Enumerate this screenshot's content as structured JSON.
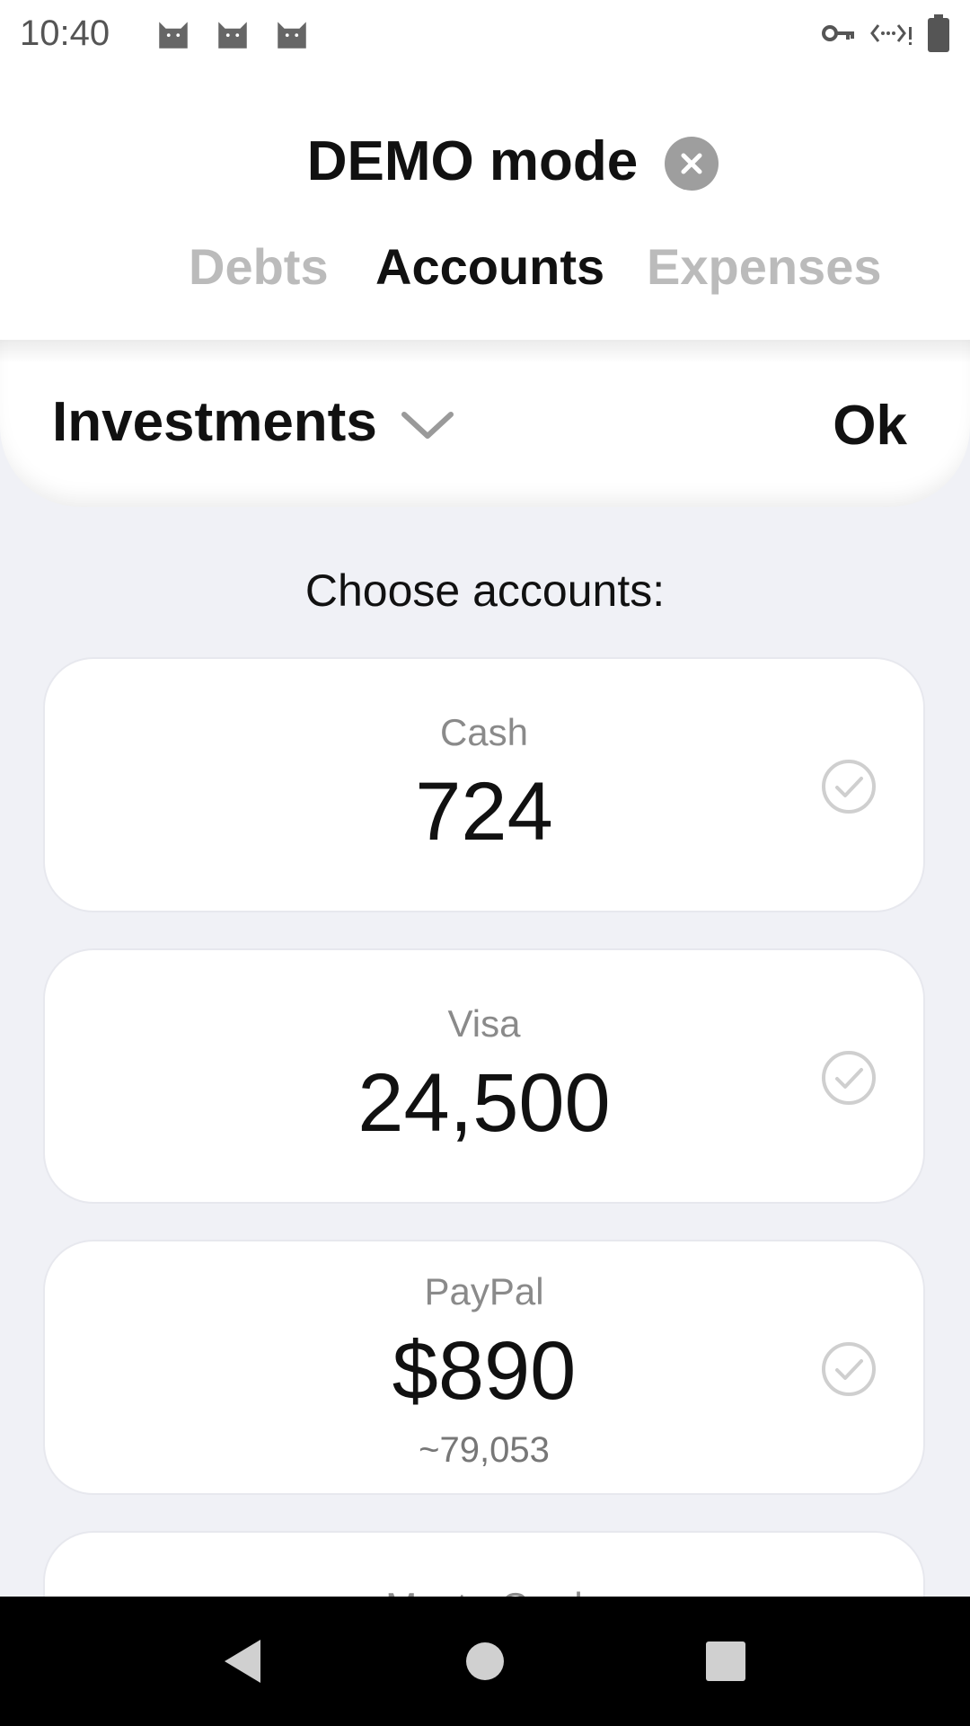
{
  "status_bar": {
    "time": "10:40",
    "notification_icons": [
      "cat-icon",
      "cat-icon",
      "cat-icon"
    ],
    "right_icons": [
      "vpn-key-icon",
      "data-sync-icon",
      "battery-icon"
    ]
  },
  "header": {
    "title": "DEMO mode",
    "tabs": [
      {
        "label": "Debts",
        "active": false
      },
      {
        "label": "Accounts",
        "active": true
      },
      {
        "label": "Expenses",
        "active": false
      }
    ]
  },
  "selector": {
    "category": "Investments",
    "ok_label": "Ok"
  },
  "prompt": "Choose accounts:",
  "accounts": [
    {
      "name": "Cash",
      "amount": "724",
      "sub": ""
    },
    {
      "name": "Visa",
      "amount": "24,500",
      "sub": ""
    },
    {
      "name": "PayPal",
      "amount": "$890",
      "sub": "~79,053"
    },
    {
      "name": "MasterCard",
      "amount": "",
      "sub": ""
    }
  ],
  "colors": {
    "background": "#f0f1f6",
    "card": "#ffffff",
    "inactive_tab": "#bbbbbb",
    "check": "#cfcfcf"
  }
}
